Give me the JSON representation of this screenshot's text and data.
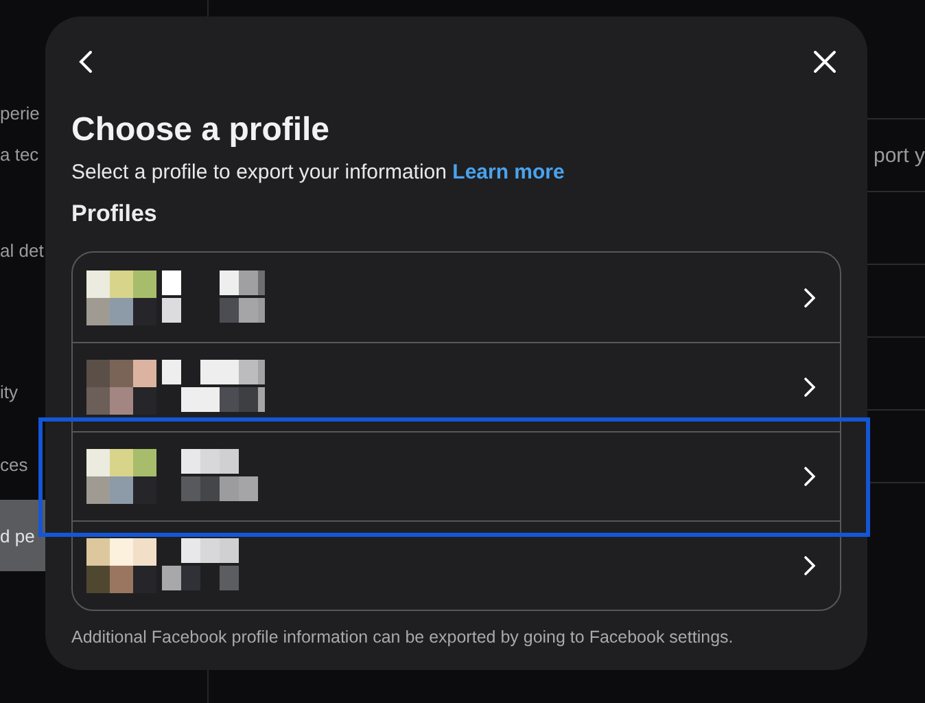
{
  "background": {
    "sidebar_items": [
      {
        "label": "perie",
        "selected": false
      },
      {
        "label": "a tec",
        "selected": false
      },
      {
        "label": "al det",
        "selected": false
      },
      {
        "label": "ity",
        "selected": false
      },
      {
        "label": "ces",
        "selected": false
      },
      {
        "label": "d pe",
        "selected": true
      }
    ],
    "content_text": "port y"
  },
  "dialog": {
    "title": "Choose a profile",
    "subtitle": "Select a profile to export your information",
    "link": "Learn more",
    "section": "Profiles",
    "profiles": [
      {
        "highlighted": false
      },
      {
        "highlighted": false
      },
      {
        "highlighted": true
      },
      {
        "highlighted": false
      }
    ],
    "footer": "Additional Facebook profile information can be exported by going to Facebook settings."
  }
}
